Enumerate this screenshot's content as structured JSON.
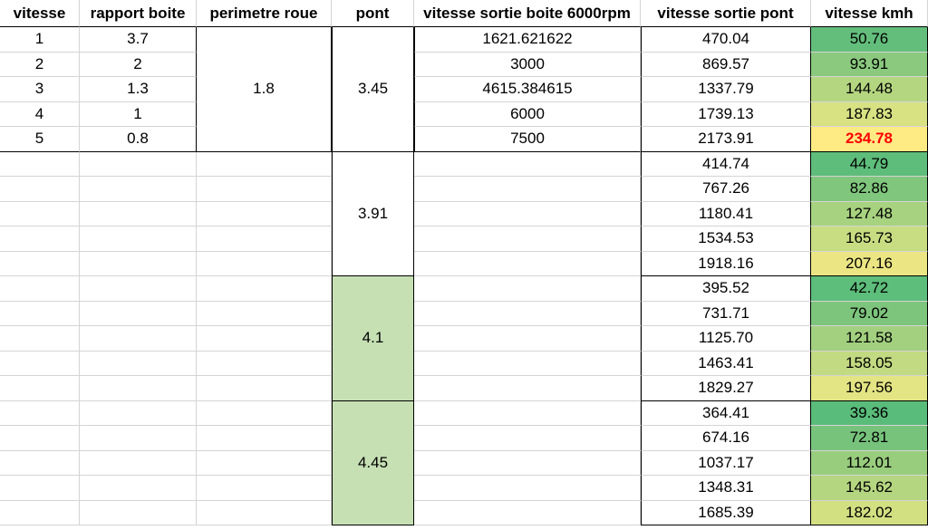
{
  "headers": {
    "vitesse": "vitesse",
    "rapport": "rapport boite",
    "perimetre": "perimetre roue",
    "pont": "pont",
    "sortie_boite": "vitesse sortie boite 6000rpm",
    "sortie_pont": "vitesse sortie pont",
    "kmh": "vitesse kmh"
  },
  "gears": [
    {
      "vitesse": "1",
      "rapport": "3.7",
      "sortie_boite": "1621.621622"
    },
    {
      "vitesse": "2",
      "rapport": "2",
      "sortie_boite": "3000"
    },
    {
      "vitesse": "3",
      "rapport": "1.3",
      "sortie_boite": "4615.384615"
    },
    {
      "vitesse": "4",
      "rapport": "1",
      "sortie_boite": "6000"
    },
    {
      "vitesse": "5",
      "rapport": "0.8",
      "sortie_boite": "7500"
    }
  ],
  "perimetre": "1.8",
  "ponts": [
    {
      "ratio": "3.45",
      "fill": "#ffffff",
      "rows": [
        {
          "pont": "470.04",
          "kmh": "50.76",
          "color": "#63be7b"
        },
        {
          "pont": "869.57",
          "kmh": "93.91",
          "color": "#8ac97e"
        },
        {
          "pont": "1337.79",
          "kmh": "144.48",
          "color": "#b4d680"
        },
        {
          "pont": "1739.13",
          "kmh": "187.83",
          "color": "#d8e283"
        },
        {
          "pont": "2173.91",
          "kmh": "234.78",
          "color": "#ffeb84",
          "highlight": true
        }
      ]
    },
    {
      "ratio": "3.91",
      "fill": "#ffffff",
      "rows": [
        {
          "pont": "414.74",
          "kmh": "44.79",
          "color": "#5ebd7a"
        },
        {
          "pont": "767.26",
          "kmh": "82.86",
          "color": "#80c67d"
        },
        {
          "pont": "1180.41",
          "kmh": "127.48",
          "color": "#a7d27f"
        },
        {
          "pont": "1534.53",
          "kmh": "165.73",
          "color": "#c8dd82"
        },
        {
          "pont": "1918.16",
          "kmh": "207.16",
          "color": "#ebe683"
        }
      ]
    },
    {
      "ratio": "4.1",
      "fill": "#c6e0b4",
      "rows": [
        {
          "pont": "395.52",
          "kmh": "42.72",
          "color": "#5dbd7a"
        },
        {
          "pont": "731.71",
          "kmh": "79.02",
          "color": "#7dc57c"
        },
        {
          "pont": "1125.70",
          "kmh": "121.58",
          "color": "#a2d07f"
        },
        {
          "pont": "1463.41",
          "kmh": "158.05",
          "color": "#c2da81"
        },
        {
          "pont": "1829.27",
          "kmh": "197.56",
          "color": "#e3e483"
        }
      ]
    },
    {
      "ratio": "4.45",
      "fill": "#c6e0b4",
      "rows": [
        {
          "pont": "364.41",
          "kmh": "39.36",
          "color": "#5abc7a"
        },
        {
          "pont": "674.16",
          "kmh": "72.81",
          "color": "#77c37c"
        },
        {
          "pont": "1037.17",
          "kmh": "112.01",
          "color": "#99cd7e"
        },
        {
          "pont": "1348.31",
          "kmh": "145.62",
          "color": "#b5d680"
        },
        {
          "pont": "1685.39",
          "kmh": "182.02",
          "color": "#d3e082"
        }
      ]
    }
  ]
}
